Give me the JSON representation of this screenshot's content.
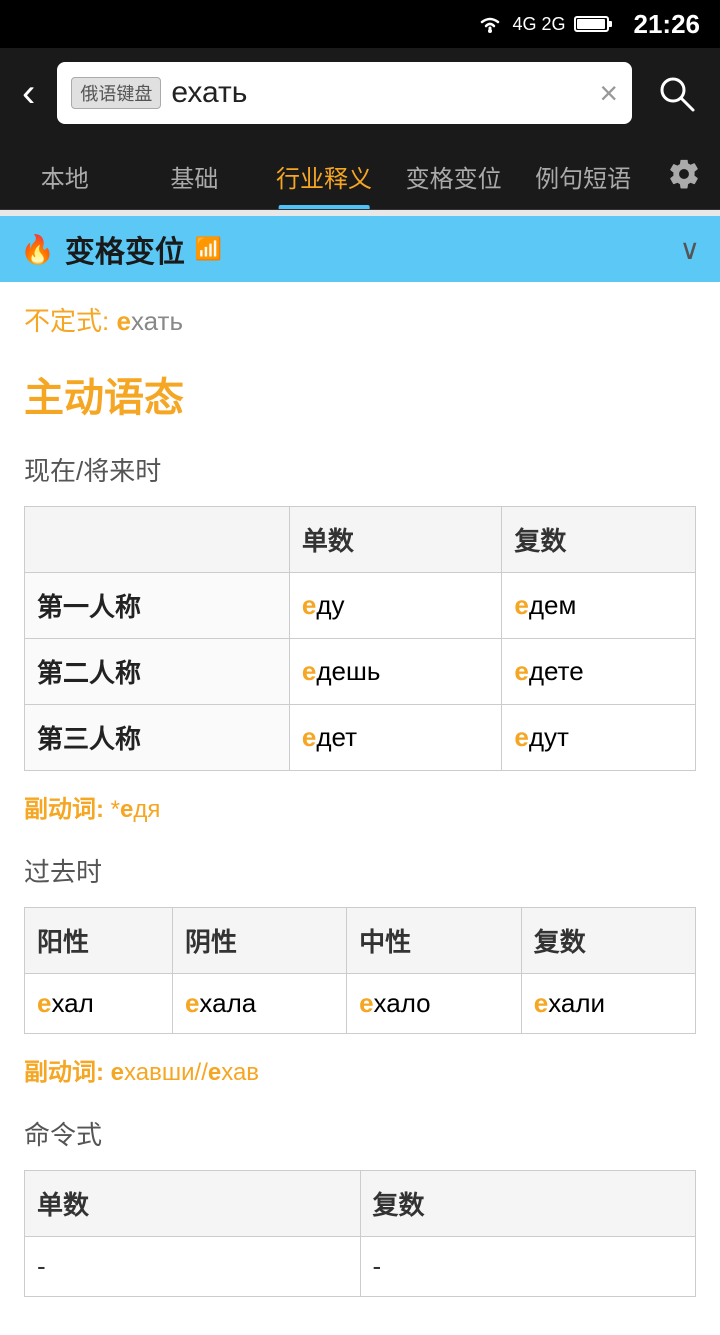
{
  "statusBar": {
    "time": "21:26",
    "icons": [
      "wifi",
      "4g/2g",
      "battery"
    ]
  },
  "searchBar": {
    "backLabel": "‹",
    "keyboardBadge": "俄语键盘",
    "inputValue": "ехать",
    "clearLabel": "×",
    "searchAriaLabel": "search"
  },
  "navTabs": {
    "tabs": [
      {
        "label": "本地",
        "active": false
      },
      {
        "label": "基础",
        "active": false
      },
      {
        "label": "行业释义",
        "active": true
      },
      {
        "label": "变格变位",
        "active": false
      },
      {
        "label": "例句短语",
        "active": false
      }
    ],
    "settingsLabel": "⚙"
  },
  "sectionHeader": {
    "title": "变格变位",
    "fireIcon": "🔥",
    "wifiIcon": "📶",
    "chevron": "∨"
  },
  "content": {
    "infinitiveLabel": "不定式:",
    "infinitiveHighlight": "е",
    "infinitiveRest": "хать",
    "sectionTitle": "主动语态",
    "presentFutureLabel": "现在/将来时",
    "presentTable": {
      "col1Header": "单数",
      "col2Header": "复数",
      "rows": [
        {
          "rowHeader": "第一人称",
          "singular": {
            "highlight": "е",
            "rest": "ду"
          },
          "plural": {
            "highlight": "е",
            "rest": "дем"
          }
        },
        {
          "rowHeader": "第二人称",
          "singular": {
            "highlight": "е",
            "rest": "дешь"
          },
          "plural": {
            "highlight": "е",
            "rest": "дете"
          }
        },
        {
          "rowHeader": "第三人称",
          "singular": {
            "highlight": "е",
            "rest": "дет"
          },
          "plural": {
            "highlight": "е",
            "rest": "дут"
          }
        }
      ]
    },
    "particulLabel": "副动词:",
    "particulValue": "*едя",
    "particulHighlight": "е",
    "particulRest": "дя",
    "pastLabel": "过去时",
    "pastTable": {
      "headers": [
        "阳性",
        "阴性",
        "中性",
        "复数"
      ],
      "row": [
        {
          "highlight": "е",
          "rest": "хал"
        },
        {
          "highlight": "е",
          "rest": "хала"
        },
        {
          "highlight": "е",
          "rest": "хало"
        },
        {
          "highlight": "е",
          "rest": "хали"
        }
      ]
    },
    "pastParticulLabel": "副动词:",
    "pastParticulValue": "ехавши//ехав",
    "pastParticulHighlight1": "е",
    "pastParticulRest1": "хавши//",
    "pastParticulHighlight2": "е",
    "pastParticulRest2": "хав",
    "imperativeLabel": "命令式",
    "imperativeTable": {
      "headers": [
        "单数",
        "复数"
      ],
      "row": [
        {
          "highlight": "-",
          "rest": ""
        },
        {
          "highlight": "-",
          "rest": ""
        }
      ]
    }
  }
}
